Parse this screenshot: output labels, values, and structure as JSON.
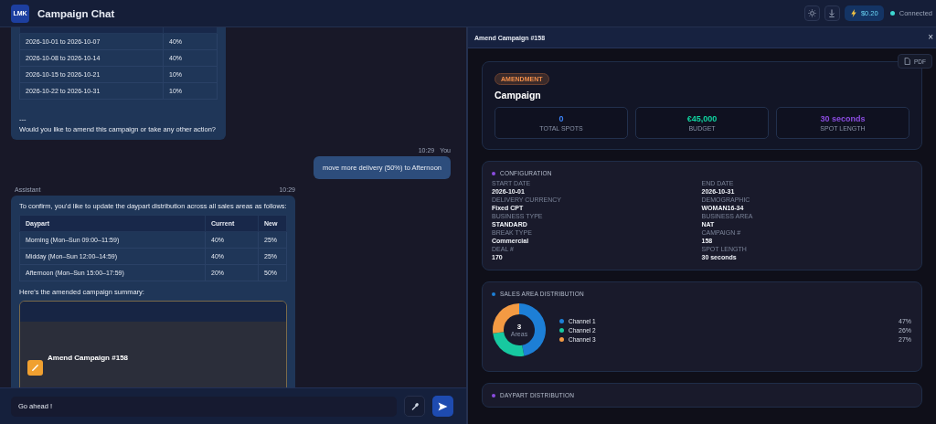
{
  "header": {
    "logo": "LMK",
    "title": "Campaign Chat",
    "cost": "$0.20",
    "status": "Connected",
    "connected": true
  },
  "chat": {
    "messages": [
      {
        "kind": "assistant",
        "blocks": [
          {
            "kind": "table",
            "rows": [
              [
                "2026-10-01 to 2026-10-07",
                "40%"
              ],
              [
                "2026-10-08 to 2026-10-14",
                "40%"
              ],
              [
                "2026-10-15 to 2026-10-21",
                "10%"
              ],
              [
                "2026-10-22 to 2026-10-31",
                "10%"
              ]
            ]
          },
          {
            "kind": "text",
            "text": "---"
          },
          {
            "kind": "text",
            "text": "Would you like to amend this campaign or take any other action?"
          }
        ]
      },
      {
        "kind": "user",
        "sender": "You",
        "time": "10:29",
        "blocks": [
          {
            "kind": "text",
            "text": "move more delivery (50%) to Afternoon"
          }
        ]
      },
      {
        "kind": "assistant",
        "sender": "Assistant",
        "time": "10:29",
        "blocks": [
          {
            "kind": "text",
            "text": "To confirm, you’d like to update the daypart distribution across all sales areas as follows:"
          },
          {
            "kind": "table",
            "columns": [
              "Daypart",
              "Current",
              "New"
            ],
            "rows": [
              [
                "Morning (Mon–Sun 09:00–11:59)",
                "40%",
                "25%"
              ],
              [
                "Midday (Mon–Sun 12:00–14:59)",
                "40%",
                "25%"
              ],
              [
                "Afternoon (Mon–Sun 15:00–17:59)",
                "20%",
                "50%"
              ]
            ]
          },
          {
            "kind": "text",
            "text": "Here's the amended campaign summary:"
          },
          {
            "kind": "card",
            "title": "Amend Campaign #158"
          }
        ]
      }
    ],
    "input": {
      "value": "Go ahead !"
    }
  },
  "panel": {
    "title": "Amend Campaign #158",
    "close": "×",
    "pdf": "PDF",
    "summary": {
      "badge": "AMENDMENT",
      "heading": "Campaign",
      "stats": [
        {
          "value": "0",
          "label": "TOTAL SPOTS",
          "color": "#3b82f6"
        },
        {
          "value": "€45,000",
          "label": "BUDGET",
          "color": "#10d5a0"
        },
        {
          "value": "30 seconds",
          "label": "SPOT LENGTH",
          "color": "#8b4ce0"
        }
      ]
    },
    "sections": [
      {
        "kind": "fields",
        "title": "CONFIGURATION",
        "color": "#8b4ce0",
        "fields": [
          {
            "label": "START DATE",
            "value": "2026-10-01"
          },
          {
            "label": "END DATE",
            "value": "2026-10-31"
          },
          {
            "label": "DELIVERY CURRENCY",
            "value": "Fixed CPT"
          },
          {
            "label": "DEMOGRAPHIC",
            "value": "WOMAN16-34"
          },
          {
            "label": "BUSINESS TYPE",
            "value": "STANDARD"
          },
          {
            "label": "BUSINESS AREA",
            "value": "NAT"
          },
          {
            "label": "BREAK TYPE",
            "value": "Commercial"
          },
          {
            "label": "CAMPAIGN #",
            "value": "158"
          },
          {
            "label": "DEAL #",
            "value": "170"
          },
          {
            "label": "SPOT LENGTH",
            "value": "30 seconds"
          }
        ]
      },
      {
        "kind": "donut",
        "title": "SALES AREA DISTRIBUTION",
        "color": "#1d7fd6",
        "center_value": "3",
        "center_label": "Areas",
        "legend": [
          {
            "value": "47%",
            "color": "#1d7fd6"
          },
          {
            "value": "26%",
            "color": "#17c9a0"
          },
          {
            "value": "27%",
            "color": "#f39a43"
          }
        ],
        "chart_data": {
          "type": "donut",
          "categories": [
            "Channel 1",
            "Channel 2",
            "Channel 3"
          ],
          "values": [
            47,
            26,
            27
          ]
        }
      },
      {
        "kind": "header",
        "title": "DAYPART DISTRIBUTION",
        "color": "#8b4ce0"
      }
    ]
  }
}
